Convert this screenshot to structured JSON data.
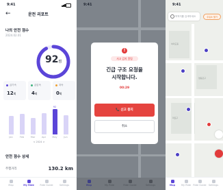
{
  "status": {
    "time": "9:41"
  },
  "report": {
    "back_glyph": "←",
    "title": "운전 리포트",
    "score_label": "나의 안전 점수",
    "score_date": "2024.02.01",
    "score_value": "92",
    "score_unit": "점",
    "score_fraction": 0.92,
    "cards": [
      {
        "label": "급가속",
        "value": "12",
        "unit": "회",
        "color": "#5b45d8"
      },
      {
        "label": "급감속",
        "value": "4",
        "unit": "회",
        "color": "#3fb27f"
      },
      {
        "label": "과속",
        "value": "0",
        "unit": "회",
        "color": "#f0a030"
      }
    ],
    "chart_data": {
      "type": "bar",
      "categories": [
        "Jan",
        "Feb",
        "Mar",
        "Apr",
        "May",
        "Jun"
      ],
      "values": [
        68,
        74,
        60,
        78,
        92,
        70
      ],
      "highlight_index": 4,
      "peak_label": "92",
      "ylim": [
        0,
        100
      ]
    },
    "period_label": "< 2024 >",
    "section_title": "안전 점수 상세",
    "distance_label": "주행거리",
    "distance_value": "130.2 km"
  },
  "tabbar": {
    "items": [
      {
        "label": "Map"
      },
      {
        "label": "My Ride"
      },
      {
        "label": "Ride Guide"
      },
      {
        "label": "Settings"
      }
    ]
  },
  "emergency": {
    "badge": "사고 감지 알림",
    "title_line1": "긴급 구조 요청을",
    "title_line2": "시작합니다.",
    "timer": "00:29",
    "call_button": "📞 신고 중지",
    "cancel_button": "취소",
    "alert_glyph": "!"
  },
  "map": {
    "search_placeholder": "목적지를 검색하세요",
    "filter_chip": "주유소 찾기",
    "labels": [
      "여의도동",
      "영등포구",
      "마포구"
    ]
  },
  "colors": {
    "accent": "#5b45d8",
    "danger": "#e23b3b"
  }
}
